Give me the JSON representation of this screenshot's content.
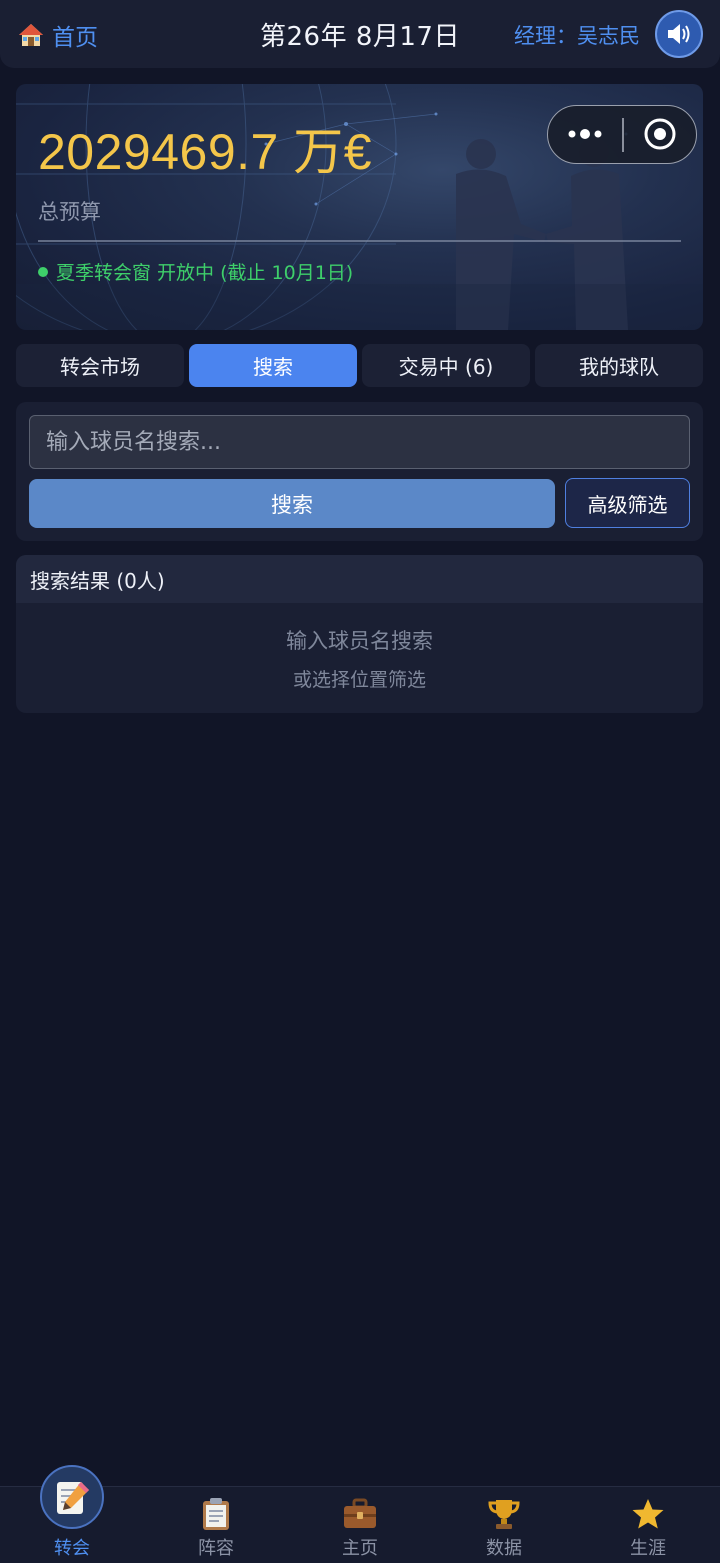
{
  "header": {
    "home_label": "首页",
    "date": "第26年 8月17日",
    "manager": "经理：吴志民",
    "home_icon": "house-icon",
    "sound_icon": "speaker-icon"
  },
  "budget": {
    "value": "2029469.7 万€",
    "label": "总预算",
    "window_status": "夏季转会窗 开放中 (截止 10月1日)"
  },
  "tabs": [
    {
      "label": "转会市场",
      "active": false
    },
    {
      "label": "搜索",
      "active": true
    },
    {
      "label": "交易中 (6)",
      "active": false
    },
    {
      "label": "我的球队",
      "active": false
    }
  ],
  "search": {
    "placeholder": "输入球员名搜索...",
    "value": "",
    "button_label": "搜索",
    "filter_label": "高级筛选"
  },
  "results": {
    "title": "搜索结果 (0人)",
    "empty_line1": "输入球员名搜索",
    "empty_line2": "或选择位置筛选"
  },
  "nav": [
    {
      "label": "转会",
      "icon": "memo-pencil-icon",
      "active": true
    },
    {
      "label": "阵容",
      "icon": "clipboard-icon",
      "active": false
    },
    {
      "label": "主页",
      "icon": "briefcase-icon",
      "active": false
    },
    {
      "label": "数据",
      "icon": "trophy-icon",
      "active": false
    },
    {
      "label": "生涯",
      "icon": "star-icon",
      "active": false
    }
  ],
  "colors": {
    "background": "#111527",
    "accent": "#4b84ef",
    "budget": "#f4c64a",
    "status_green": "#3ecf6a"
  }
}
